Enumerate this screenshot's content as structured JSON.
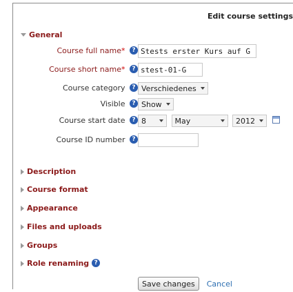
{
  "page": {
    "title": "Edit course settings"
  },
  "general": {
    "legend": "General",
    "fields": {
      "fullname": {
        "label": "Course full name",
        "required": "*",
        "value": "Stests erster Kurs auf G"
      },
      "shortname": {
        "label": "Course short name",
        "required": "*",
        "value": "stest-01-G"
      },
      "category": {
        "label": "Course category",
        "value": "Verschiedenes"
      },
      "visible": {
        "label": "Visible",
        "value": "Show"
      },
      "startdate": {
        "label": "Course start date",
        "day": "8",
        "month": "May",
        "year": "2012"
      },
      "idnumber": {
        "label": "Course ID number",
        "value": ""
      }
    },
    "help_glyph": "?"
  },
  "sections": {
    "description": "Description",
    "format": "Course format",
    "appearance": "Appearance",
    "files": "Files and uploads",
    "groups": "Groups",
    "roles": "Role renaming"
  },
  "actions": {
    "save": "Save changes",
    "cancel": "Cancel"
  },
  "colors": {
    "legend": "#8b1a1a",
    "help": "#2a5db0",
    "link": "#2a6db0"
  },
  "icons": {
    "help": "help-icon",
    "calendar": "calendar-icon",
    "expand": "expand-icon",
    "collapse": "collapse-icon"
  }
}
